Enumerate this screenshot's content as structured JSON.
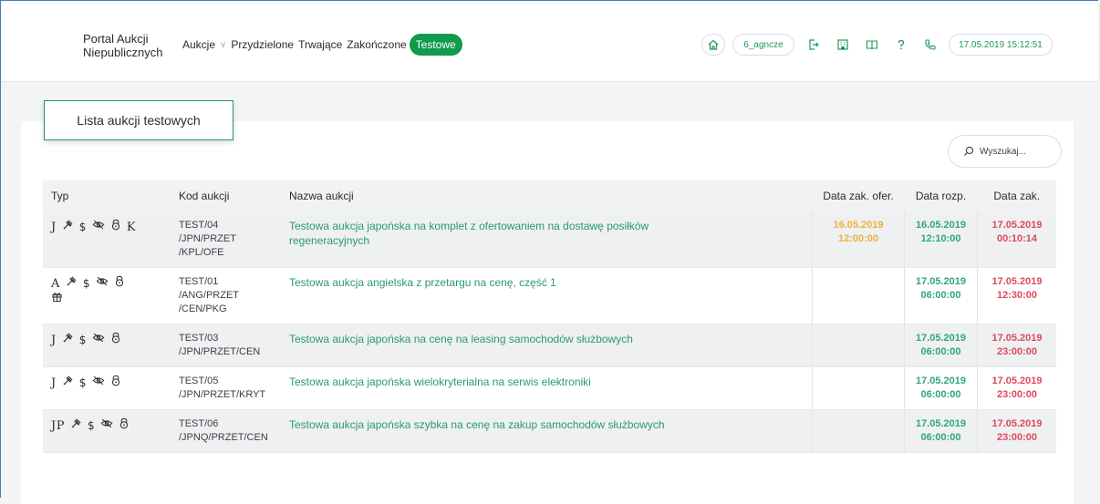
{
  "header": {
    "brand_line1": "Portal Aukcji",
    "brand_line2": "Niepublicznych",
    "nav": [
      "Aukcje",
      "Przydzielone",
      "Trwające",
      "Zakończone",
      "Testowe"
    ],
    "active_nav": "Testowe",
    "user": "6_agncze",
    "datetime": "17.05.2019 15:12:51"
  },
  "page": {
    "title": "Lista aukcji testowych",
    "search_placeholder": "Wyszukaj..."
  },
  "table": {
    "columns": [
      "Typ",
      "Kod aukcji",
      "Nazwa aukcji",
      "Data zak. ofer.",
      "Data rozp.",
      "Data zak."
    ],
    "rows": [
      {
        "type": "J",
        "type_icons": [
          "gavel-icon",
          "dollar-icon",
          "eye-off-icon",
          "lock-icon",
          "k-letter"
        ],
        "code": "TEST/04 /JPN/PRZET /KPL/OFE",
        "code_lines": [
          "TEST/04",
          "/JPN/PRZET",
          "/KPL/OFE"
        ],
        "name": "Testowa aukcja japońska na komplet z ofertowaniem na dostawę posiłków regeneracyjnych",
        "offer_end": [
          "16.05.2019",
          "12:00:00"
        ],
        "start": [
          "16.05.2019",
          "12:10:00"
        ],
        "end": [
          "17.05.2019",
          "00:10:14"
        ]
      },
      {
        "type": "A",
        "type_icons": [
          "gavel-icon",
          "dollar-icon",
          "eye-off-icon",
          "lock-icon",
          "gift-icon"
        ],
        "code_lines": [
          "TEST/01",
          "/ANG/PRZET",
          "/CEN/PKG"
        ],
        "name": "Testowa aukcja angielska z przetargu na cenę, część 1",
        "offer_end": [
          "",
          ""
        ],
        "start": [
          "17.05.2019",
          "06:00:00"
        ],
        "end": [
          "17.05.2019",
          "12:30:00"
        ]
      },
      {
        "type": "J",
        "type_icons": [
          "gavel-icon",
          "dollar-icon",
          "eye-off-icon",
          "lock-icon"
        ],
        "code_lines": [
          "TEST/03",
          "/JPN/PRZET/CEN"
        ],
        "name": "Testowa aukcja japońska na cenę na leasing samochodów służbowych",
        "offer_end": [
          "",
          ""
        ],
        "start": [
          "17.05.2019",
          "06:00:00"
        ],
        "end": [
          "17.05.2019",
          "23:00:00"
        ]
      },
      {
        "type": "J",
        "type_icons": [
          "gavel-icon",
          "dollar-icon",
          "eye-off-icon",
          "lock-icon"
        ],
        "code_lines": [
          "TEST/05",
          "/JPN/PRZET/KRYT"
        ],
        "name": "Testowa aukcja japońska wielokryterialna na serwis elektroniki",
        "offer_end": [
          "",
          ""
        ],
        "start": [
          "17.05.2019",
          "06:00:00"
        ],
        "end": [
          "17.05.2019",
          "23:00:00"
        ]
      },
      {
        "type": "JP",
        "type_icons": [
          "gavel-icon",
          "dollar-icon",
          "eye-off-icon",
          "lock-icon"
        ],
        "code_lines": [
          "TEST/06",
          "/JPNQ/PRZET/CEN"
        ],
        "name": "Testowa aukcja japońska szybka na cenę na zakup samochodów służbowych",
        "offer_end": [
          "",
          ""
        ],
        "start": [
          "17.05.2019",
          "06:00:00"
        ],
        "end": [
          "17.05.2019",
          "23:00:00"
        ]
      }
    ]
  },
  "colors": {
    "accent": "#119a4d",
    "link": "#2a9b66",
    "date_orange": "#f0b13a",
    "date_green": "#2fa877",
    "date_red": "#e0475c"
  }
}
